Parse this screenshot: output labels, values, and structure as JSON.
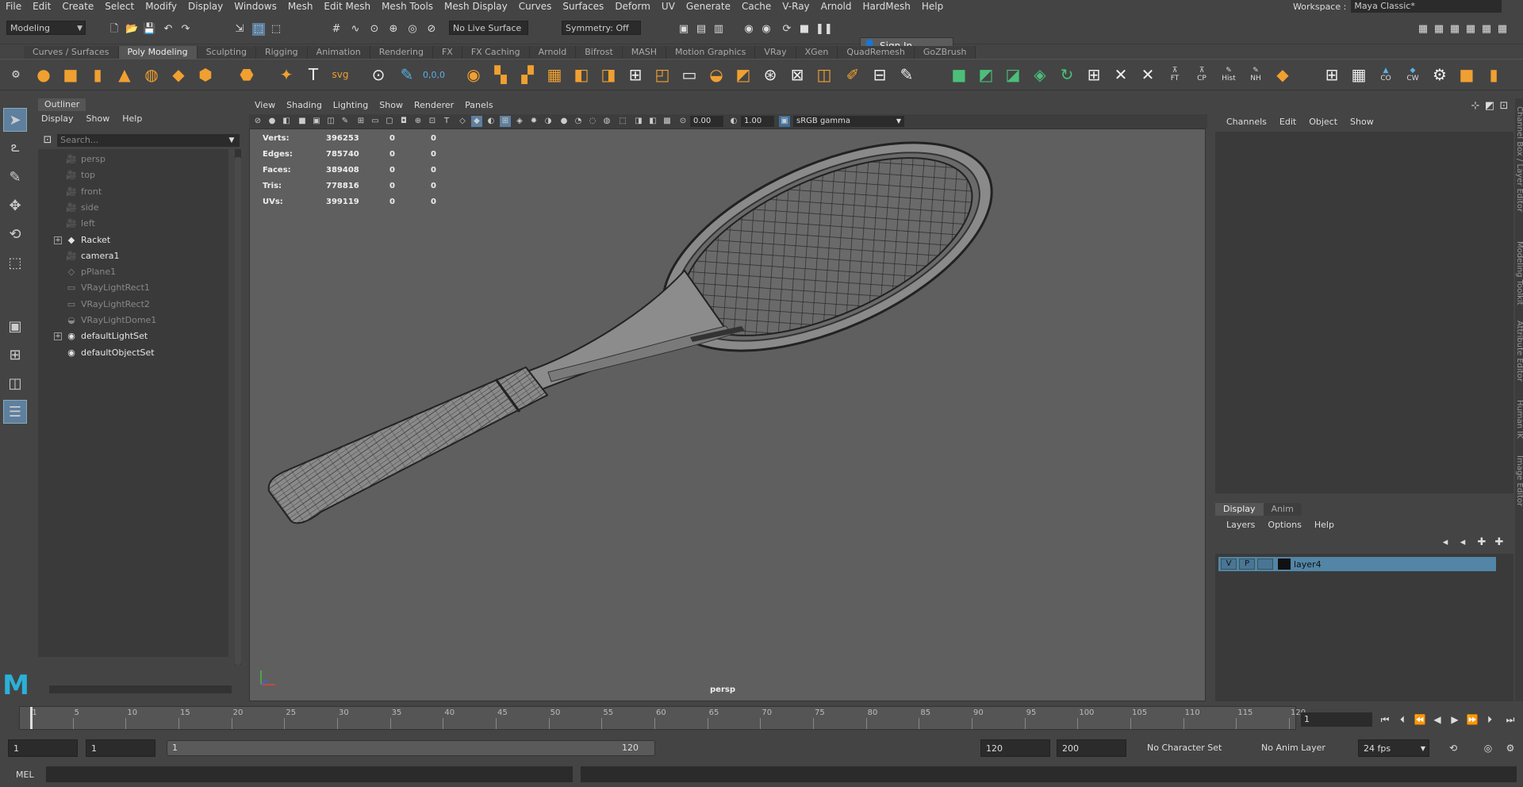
{
  "menubar": {
    "items": [
      "File",
      "Edit",
      "Create",
      "Select",
      "Modify",
      "Display",
      "Windows",
      "Mesh",
      "Edit Mesh",
      "Mesh Tools",
      "Mesh Display",
      "Curves",
      "Surfaces",
      "Deform",
      "UV",
      "Generate",
      "Cache",
      "V-Ray",
      "Arnold",
      "HardMesh",
      "Help"
    ],
    "workspace_label": "Workspace :",
    "workspace_value": "Maya Classic*"
  },
  "statusline": {
    "mode": "Modeling",
    "live_surface": "No Live Surface",
    "symmetry": "Symmetry: Off",
    "sign_in": "Sign In"
  },
  "shelf": {
    "tabs": [
      "Curves / Surfaces",
      "Poly Modeling",
      "Sculpting",
      "Rigging",
      "Animation",
      "Rendering",
      "FX",
      "FX Caching",
      "Arnold",
      "Bifrost",
      "MASH",
      "Motion Graphics",
      "VRay",
      "XGen",
      "QuadRemesh",
      "GoZBrush"
    ],
    "active_tab": "Poly Modeling",
    "labeled_buttons": [
      "FT",
      "CP",
      "Hist",
      "NH",
      "CO",
      "CW"
    ]
  },
  "outliner": {
    "title": "Outliner",
    "menu": [
      "Display",
      "Show",
      "Help"
    ],
    "search_placeholder": "Search...",
    "items": [
      {
        "label": "persp",
        "icon": "camera-icon",
        "dim": true,
        "expandable": false
      },
      {
        "label": "top",
        "icon": "camera-icon",
        "dim": true,
        "expandable": false
      },
      {
        "label": "front",
        "icon": "camera-icon",
        "dim": true,
        "expandable": false
      },
      {
        "label": "side",
        "icon": "camera-icon",
        "dim": true,
        "expandable": false
      },
      {
        "label": "left",
        "icon": "camera-icon",
        "dim": true,
        "expandable": false
      },
      {
        "label": "Racket",
        "icon": "mesh-group-icon",
        "dim": false,
        "expandable": true
      },
      {
        "label": "camera1",
        "icon": "camera-icon",
        "dim": false,
        "expandable": false
      },
      {
        "label": "pPlane1",
        "icon": "plane-icon",
        "dim": true,
        "expandable": false
      },
      {
        "label": "VRayLightRect1",
        "icon": "rect-light-icon",
        "dim": true,
        "expandable": false
      },
      {
        "label": "VRayLightRect2",
        "icon": "rect-light-icon",
        "dim": true,
        "expandable": false
      },
      {
        "label": "VRayLightDome1",
        "icon": "dome-light-icon",
        "dim": true,
        "expandable": false
      },
      {
        "label": "defaultLightSet",
        "icon": "set-icon",
        "dim": false,
        "expandable": true
      },
      {
        "label": "defaultObjectSet",
        "icon": "set-icon",
        "dim": false,
        "expandable": false
      }
    ]
  },
  "viewport": {
    "menu": [
      "View",
      "Shading",
      "Lighting",
      "Show",
      "Renderer",
      "Panels"
    ],
    "exposure": "0.00",
    "gamma": "1.00",
    "color_space": "sRGB gamma",
    "camera": "persp",
    "hud": [
      {
        "label": "Verts:",
        "v1": "396253",
        "v2": "0",
        "v3": "0"
      },
      {
        "label": "Edges:",
        "v1": "785740",
        "v2": "0",
        "v3": "0"
      },
      {
        "label": "Faces:",
        "v1": "389408",
        "v2": "0",
        "v3": "0"
      },
      {
        "label": "Tris:",
        "v1": "778816",
        "v2": "0",
        "v3": "0"
      },
      {
        "label": "UVs:",
        "v1": "399119",
        "v2": "0",
        "v3": "0"
      }
    ]
  },
  "channelbox": {
    "menu": [
      "Channels",
      "Edit",
      "Object",
      "Show"
    ]
  },
  "layer_editor": {
    "tabs": [
      "Display",
      "Anim"
    ],
    "active_tab": "Display",
    "menu": [
      "Layers",
      "Options",
      "Help"
    ],
    "layers": [
      {
        "visible": "V",
        "playback": "P",
        "name": "layer4"
      }
    ]
  },
  "side_tabs": [
    "Channel Box / Layer Editor",
    "Modeling Toolkit",
    "Attribute Editor",
    "Human IK",
    "Image Editor"
  ],
  "timeline": {
    "ticks": [
      "1",
      "5",
      "10",
      "15",
      "20",
      "25",
      "30",
      "35",
      "40",
      "45",
      "50",
      "55",
      "60",
      "65",
      "70",
      "75",
      "80",
      "85",
      "90",
      "95",
      "100",
      "105",
      "110",
      "115",
      "120"
    ],
    "current_frame": "1"
  },
  "range": {
    "start": "1",
    "anim_start": "1",
    "range_start_label": "1",
    "range_end_label": "120",
    "anim_end": "120",
    "end": "200",
    "character_set": "No Character Set",
    "anim_layer": "No Anim Layer",
    "fps": "24 fps"
  },
  "command_line": {
    "label": "MEL"
  },
  "colors": {
    "accent": "#5285a6",
    "logo": "#2bb0d8"
  }
}
